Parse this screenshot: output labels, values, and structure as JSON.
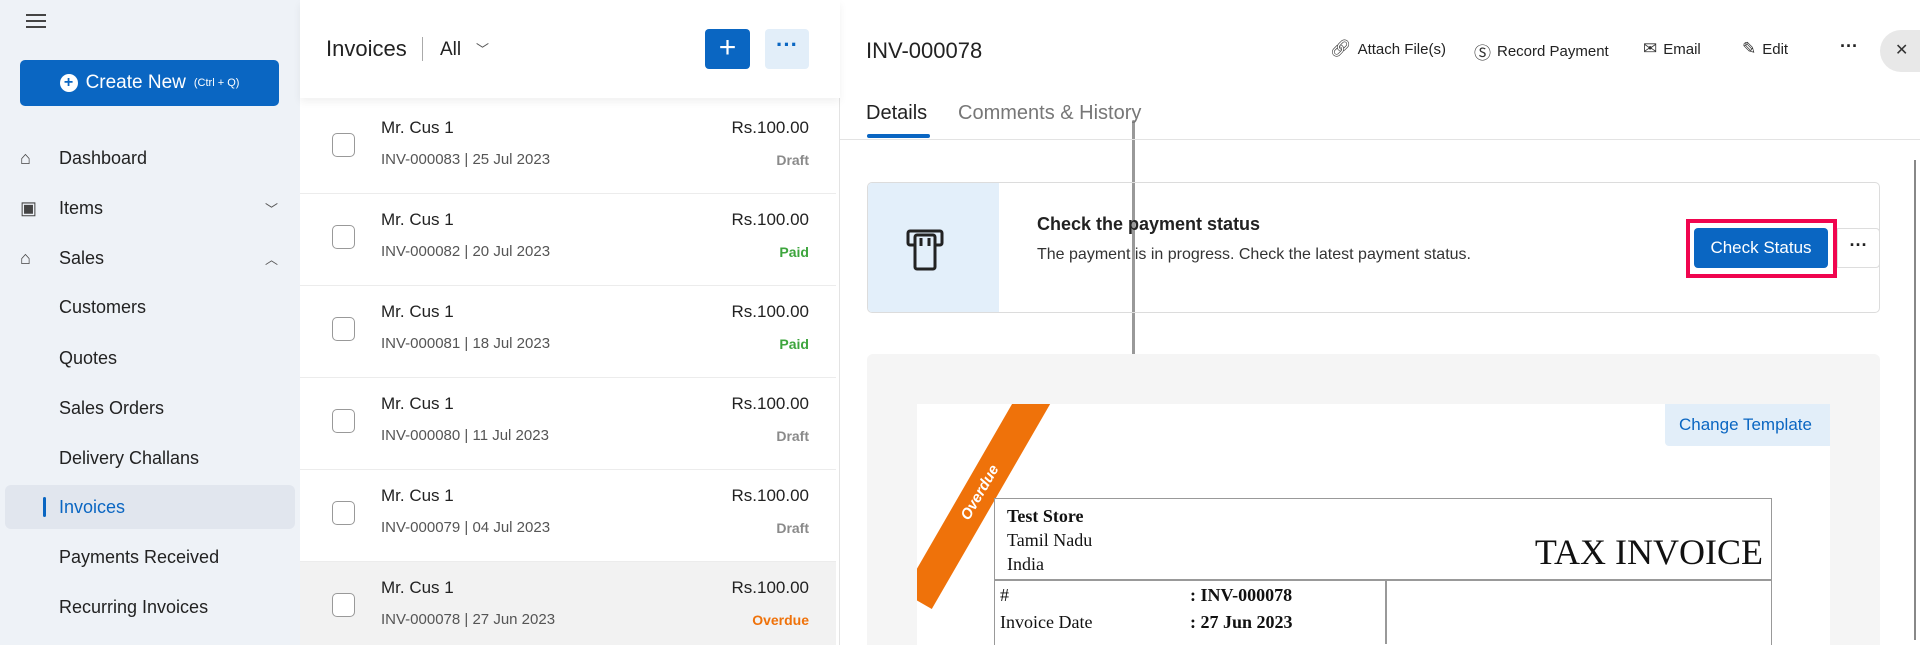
{
  "sidebar": {
    "create_label": "Create New",
    "create_shortcut": "(Ctrl + Q)",
    "items": [
      {
        "label": "Dashboard",
        "icon": "home-icon"
      },
      {
        "label": "Items",
        "icon": "box-icon"
      },
      {
        "label": "Sales",
        "icon": "store-icon"
      },
      {
        "label": "Customers"
      },
      {
        "label": "Quotes"
      },
      {
        "label": "Sales Orders"
      },
      {
        "label": "Delivery Challans"
      },
      {
        "label": "Invoices",
        "active": true
      },
      {
        "label": "Payments Received"
      },
      {
        "label": "Recurring Invoices"
      }
    ]
  },
  "list": {
    "title": "Invoices",
    "filter": "All",
    "rows": [
      {
        "name": "Mr. Cus 1",
        "number": "INV-000083",
        "date": "25 Jul 2023",
        "amount": "Rs.100.00",
        "status": "Draft"
      },
      {
        "name": "Mr. Cus 1",
        "number": "INV-000082",
        "date": "20 Jul 2023",
        "amount": "Rs.100.00",
        "status": "Paid"
      },
      {
        "name": "Mr. Cus 1",
        "number": "INV-000081",
        "date": "18 Jul 2023",
        "amount": "Rs.100.00",
        "status": "Paid"
      },
      {
        "name": "Mr. Cus 1",
        "number": "INV-000080",
        "date": "11 Jul 2023",
        "amount": "Rs.100.00",
        "status": "Draft"
      },
      {
        "name": "Mr. Cus 1",
        "number": "INV-000079",
        "date": "04 Jul 2023",
        "amount": "Rs.100.00",
        "status": "Draft"
      },
      {
        "name": "Mr. Cus 1",
        "number": "INV-000078",
        "date": "27 Jun 2023",
        "amount": "Rs.100.00",
        "status": "Overdue"
      }
    ],
    "status_colors": {
      "Draft": "#8a8a8a",
      "Paid": "#3da53d",
      "Overdue": "#ef720a"
    }
  },
  "detail": {
    "title": "INV-000078",
    "actions": {
      "attach": "Attach File(s)",
      "record": "Record Payment",
      "email": "Email",
      "edit": "Edit"
    },
    "tabs": {
      "details": "Details",
      "comments": "Comments & History"
    },
    "banner": {
      "title": "Check the payment status",
      "desc": "The payment is in progress. Check the latest payment status.",
      "button": "Check Status"
    },
    "preview": {
      "ribbon": "Overdue",
      "change_template": "Change Template",
      "store": "Test Store",
      "state": "Tamil Nadu",
      "country": "India",
      "doc_title": "TAX INVOICE",
      "num_label": "#",
      "num_value": ": INV-000078",
      "date_label": "Invoice Date",
      "date_value": ": 27 Jun 2023"
    }
  }
}
